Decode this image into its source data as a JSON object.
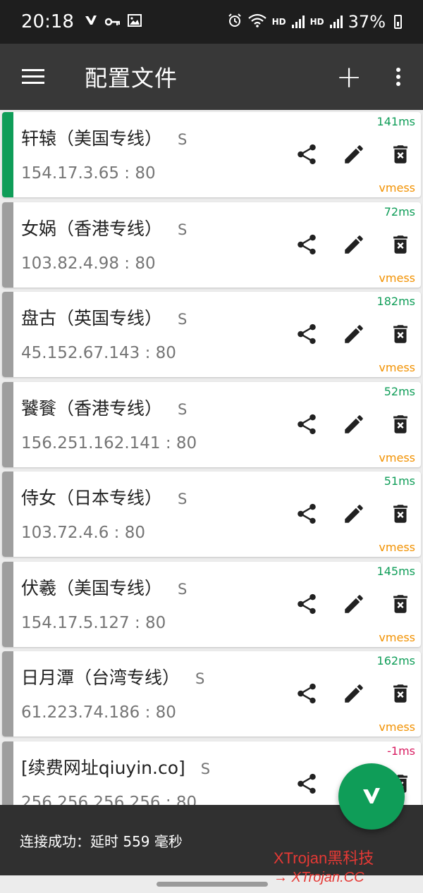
{
  "status_bar": {
    "time": "20:18",
    "hd1": "HD",
    "hd2": "HD",
    "battery": "37%"
  },
  "app_bar": {
    "title": "配置文件",
    "add_label": "+"
  },
  "servers": [
    {
      "name": "轩辕（美国专线）",
      "type": "S",
      "address": "154.17.3.65 : 80",
      "latency": "141ms",
      "protocol": "vmess",
      "active": true
    },
    {
      "name": "女娲（香港专线）",
      "type": "S",
      "address": "103.82.4.98 : 80",
      "latency": "72ms",
      "protocol": "vmess",
      "active": false
    },
    {
      "name": "盘古（英国专线）",
      "type": "S",
      "address": "45.152.67.143 : 80",
      "latency": "182ms",
      "protocol": "vmess",
      "active": false
    },
    {
      "name": "饕餮（香港专线）",
      "type": "S",
      "address": "156.251.162.141 : 80",
      "latency": "52ms",
      "protocol": "vmess",
      "active": false
    },
    {
      "name": "侍女（日本专线）",
      "type": "S",
      "address": "103.72.4.6 : 80",
      "latency": "51ms",
      "protocol": "vmess",
      "active": false
    },
    {
      "name": "伏羲（美国专线）",
      "type": "S",
      "address": "154.17.5.127 : 80",
      "latency": "145ms",
      "protocol": "vmess",
      "active": false
    },
    {
      "name": "日月潭（台湾专线）",
      "type": "S",
      "address": "61.223.74.186 : 80",
      "latency": "162ms",
      "protocol": "vmess",
      "active": false
    },
    {
      "name": "[续费网址qiuyin.co]",
      "type": "S",
      "address": "256.256.256.256 : 80",
      "latency": "-1ms",
      "protocol": "",
      "active": false
    }
  ],
  "snackbar": {
    "message": "连接成功：延时 559 毫秒"
  },
  "watermark": {
    "line1": "XTrojan黑科技",
    "line2": "→ XTrojan.CC"
  },
  "colors": {
    "accent": "#0f9d58",
    "protocol": "#f29100",
    "latency_bad": "#d81b60",
    "app_bar": "#383838"
  }
}
